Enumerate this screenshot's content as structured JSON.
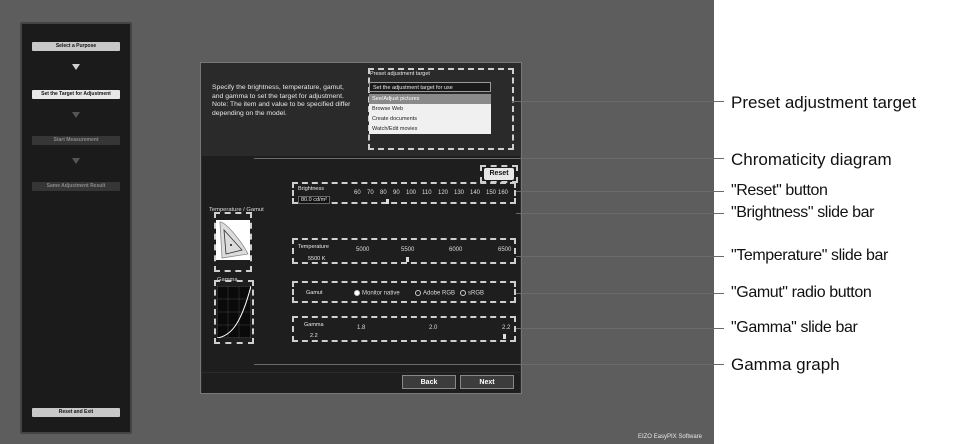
{
  "sidebar": {
    "steps": [
      "Select a Purpose",
      "Set the Target for Adjustment",
      "Start Measurement",
      "Same Adjustment Result"
    ],
    "reset_exit": "Reset and Exit"
  },
  "instructions": "Specify the brightness, temperature, gamut, and gamma to set the target for adjustment. Note: The item and value to be specified differ depending on the model.",
  "preset": {
    "title": "Preset adjustment target",
    "select_value": "Set the adjustment target for use",
    "options": [
      "See/Adjust pictures",
      "Browse Web",
      "Create documents",
      "Watch/Edit movies"
    ],
    "selected_index": 0
  },
  "chromaticity_label": "Temperature / Gamut",
  "gamma_graph_label": "Gamma",
  "reset_label": "Reset",
  "brightness": {
    "label": "Brightness",
    "value": "80.0 cd/m²",
    "ticks": [
      "60",
      "70",
      "80",
      "90",
      "100",
      "110",
      "120",
      "130",
      "140",
      "150",
      "160"
    ]
  },
  "temperature": {
    "label": "Temperature",
    "value": "5500 K",
    "ticks": [
      "5000",
      "5500",
      "6000",
      "6500"
    ]
  },
  "gamut": {
    "label": "Gamut",
    "options": [
      "Monitor native",
      "Adobe RGB",
      "sRGB"
    ],
    "selected_index": 0
  },
  "gamma": {
    "label": "Gamma",
    "value": "2.2",
    "ticks": [
      "1.8",
      "2.0",
      "2.2"
    ]
  },
  "buttons": {
    "back": "Back",
    "next": "Next"
  },
  "brand": "EIZO EasyPIX Software",
  "callouts": [
    "Preset adjustment target",
    "Chromaticity diagram",
    "\"Reset\" button",
    "\"Brightness\" slide bar",
    "\"Temperature\" slide bar",
    "\"Gamut\" radio button",
    "\"Gamma\" slide bar",
    "Gamma graph"
  ]
}
